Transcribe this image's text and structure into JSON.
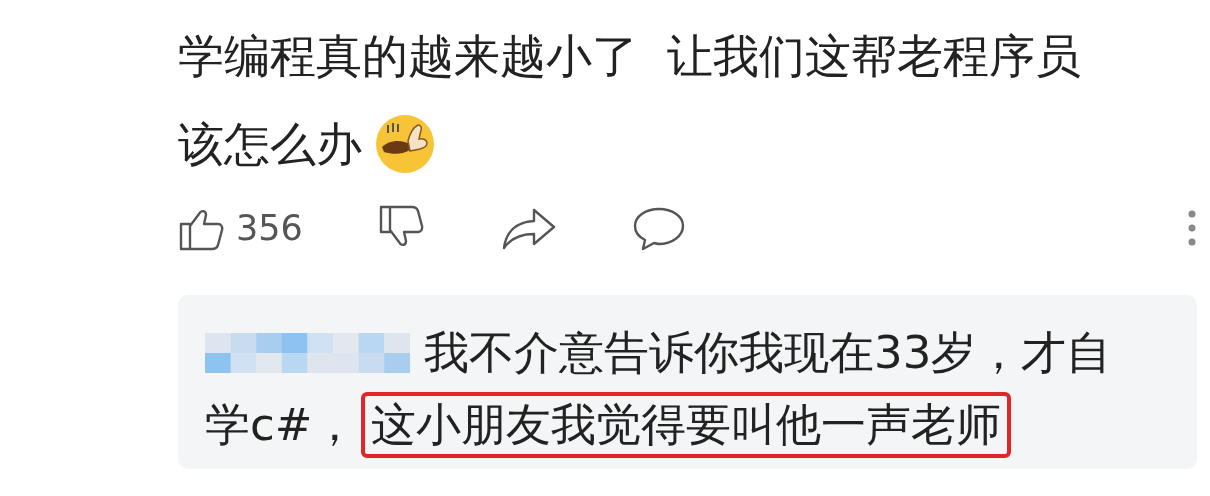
{
  "post": {
    "lines": [
      "学编程真的越来越小了  让我们这帮老程序员",
      "该怎么办"
    ]
  },
  "actions": {
    "like_count": "356"
  },
  "reply": {
    "lines": [
      "我不介意告诉你我现在33岁，才自",
      "学c#，"
    ],
    "highlighted": "这小朋友我觉得要叫他一声老师"
  }
}
